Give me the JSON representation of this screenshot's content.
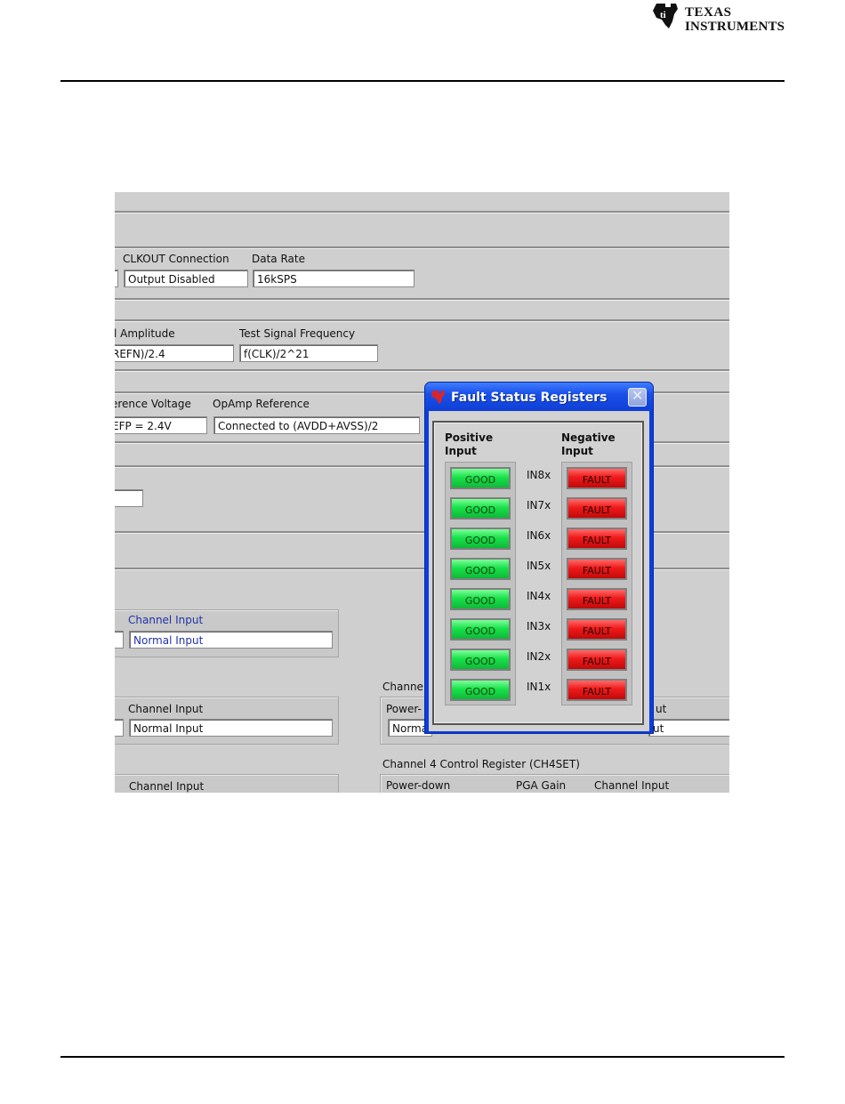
{
  "header": {
    "logo_line1": "Texas",
    "logo_line2": "Instruments"
  },
  "screenshot": {
    "labels": {
      "clkout_connection": "CLKOUT Connection",
      "data_rate": "Data Rate",
      "amplitude": "l Amplitude",
      "test_signal_frequency": "Test Signal Frequency",
      "reference_voltage": "erence Voltage",
      "opamp_reference": "OpAmp Reference",
      "channel_input_1": "Channel Input",
      "channel_input_2": "Channel Input",
      "channel_input_3": "Channel Input",
      "channel_partial": "Channel",
      "power_partial": "Power-",
      "ut_partial": "ut",
      "ch4_register": "Channel 4 Control Register (CH4SET)",
      "power_down": "Power-down",
      "pga_gain": "PGA Gain",
      "channel_input_4": "Channel Input"
    },
    "fields": {
      "clkout_value": "Output Disabled",
      "data_rate_value": "16kSPS",
      "amplitude_value": "REFN)/2.4",
      "test_freq_value": "f(CLK)/2^21",
      "ref_voltage_value": "EFP = 2.4V",
      "opamp_ref_value": "Connected to (AVDD+AVSS)/2",
      "channel_input_1_value": "Normal Input",
      "channel_input_2_value": "Normal Input",
      "norma_partial": "Norma",
      "ut_field_partial": "ut"
    }
  },
  "dialog": {
    "title": "Fault Status Registers",
    "close_symbol": "✕",
    "positive_header": "Positive Input",
    "negative_header": "Negative Input",
    "rows": [
      {
        "channel": "IN8x",
        "positive": "GOOD",
        "negative": "FAULT"
      },
      {
        "channel": "IN7x",
        "positive": "GOOD",
        "negative": "FAULT"
      },
      {
        "channel": "IN6x",
        "positive": "GOOD",
        "negative": "FAULT"
      },
      {
        "channel": "IN5x",
        "positive": "GOOD",
        "negative": "FAULT"
      },
      {
        "channel": "IN4x",
        "positive": "GOOD",
        "negative": "FAULT"
      },
      {
        "channel": "IN3x",
        "positive": "GOOD",
        "negative": "FAULT"
      },
      {
        "channel": "IN2x",
        "positive": "GOOD",
        "negative": "FAULT"
      },
      {
        "channel": "IN1x",
        "positive": "GOOD",
        "negative": "FAULT"
      }
    ]
  },
  "colors": {
    "good": "#19e24a",
    "fault": "#f01a1a",
    "titlebar": "#1a50e8",
    "panel_bg": "#cfcfcf"
  }
}
